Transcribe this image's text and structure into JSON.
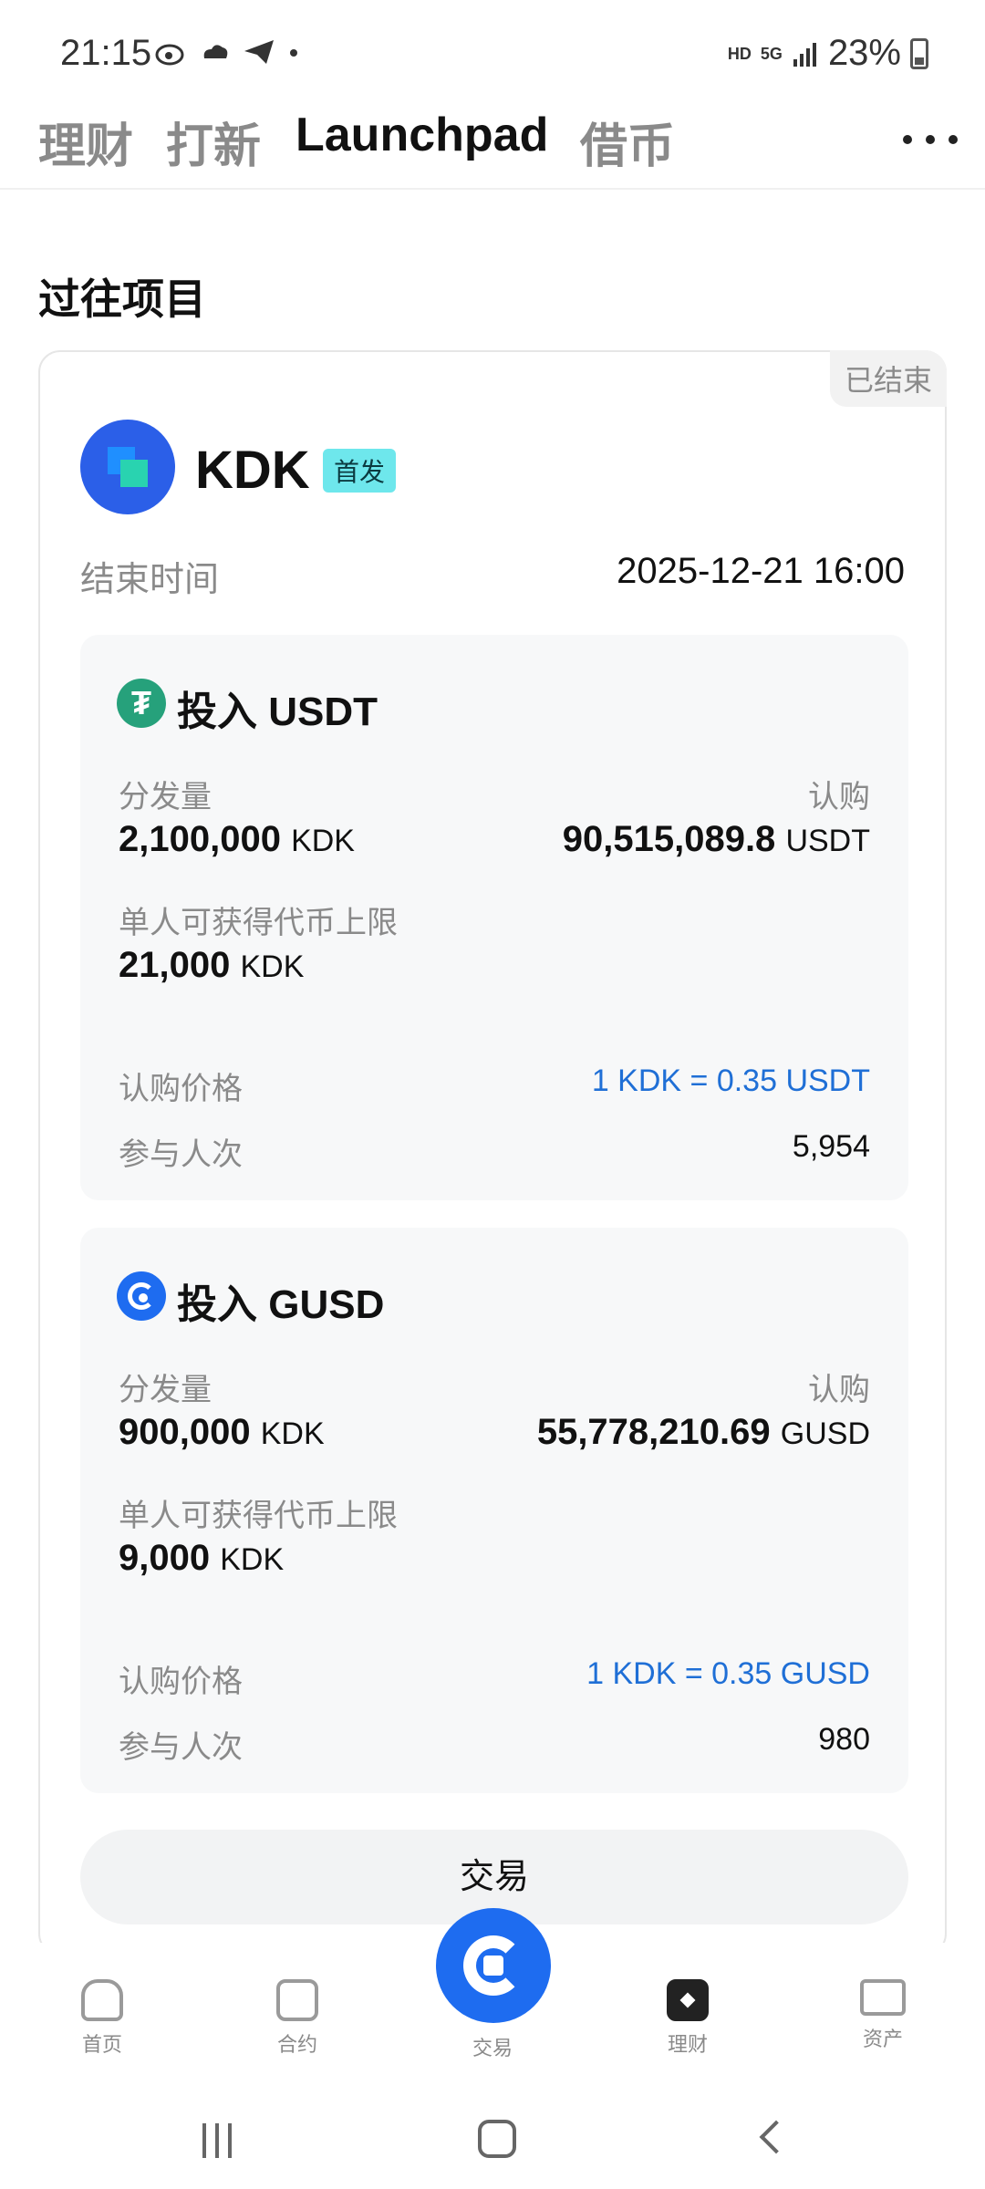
{
  "status_bar": {
    "time": "21:15",
    "hd": "HD",
    "network": "5G",
    "battery": "23%"
  },
  "top_tabs": [
    "理财",
    "打新",
    "Launchpad",
    "借币"
  ],
  "section_title": "过往项目",
  "project": {
    "status": "已结束",
    "name": "KDK",
    "badge": "首发",
    "end_label": "结束时间",
    "end_value": "2025-12-21 16:00"
  },
  "pools": [
    {
      "title": "投入 USDT",
      "icon_glyph": "₮",
      "dist_label": "分发量",
      "dist_value": "2,100,000",
      "dist_unit": "KDK",
      "subs_label": "认购",
      "subs_value": "90,515,089.8",
      "subs_unit": "USDT",
      "cap_label": "单人可获得代币上限",
      "cap_value": "21,000",
      "cap_unit": "KDK",
      "price_label": "认购价格",
      "price_value": "1 KDK = 0.35 USDT",
      "participants_label": "参与人次",
      "participants_value": "5,954"
    },
    {
      "title": "投入 GUSD",
      "dist_label": "分发量",
      "dist_value": "900,000",
      "dist_unit": "KDK",
      "subs_label": "认购",
      "subs_value": "55,778,210.69",
      "subs_unit": "GUSD",
      "cap_label": "单人可获得代币上限",
      "cap_value": "9,000",
      "cap_unit": "KDK",
      "price_label": "认购价格",
      "price_value": "1 KDK = 0.35 GUSD",
      "participants_label": "参与人次",
      "participants_value": "980"
    }
  ],
  "trade_button": "交易",
  "bottom_nav": [
    "首页",
    "合约",
    "交易",
    "理财",
    "资产"
  ],
  "colors": {
    "accent_blue": "#1e6cf0",
    "price_blue": "#1f6fd6",
    "tether_green": "#26a17b",
    "badge_cyan": "#6ee7ec"
  }
}
